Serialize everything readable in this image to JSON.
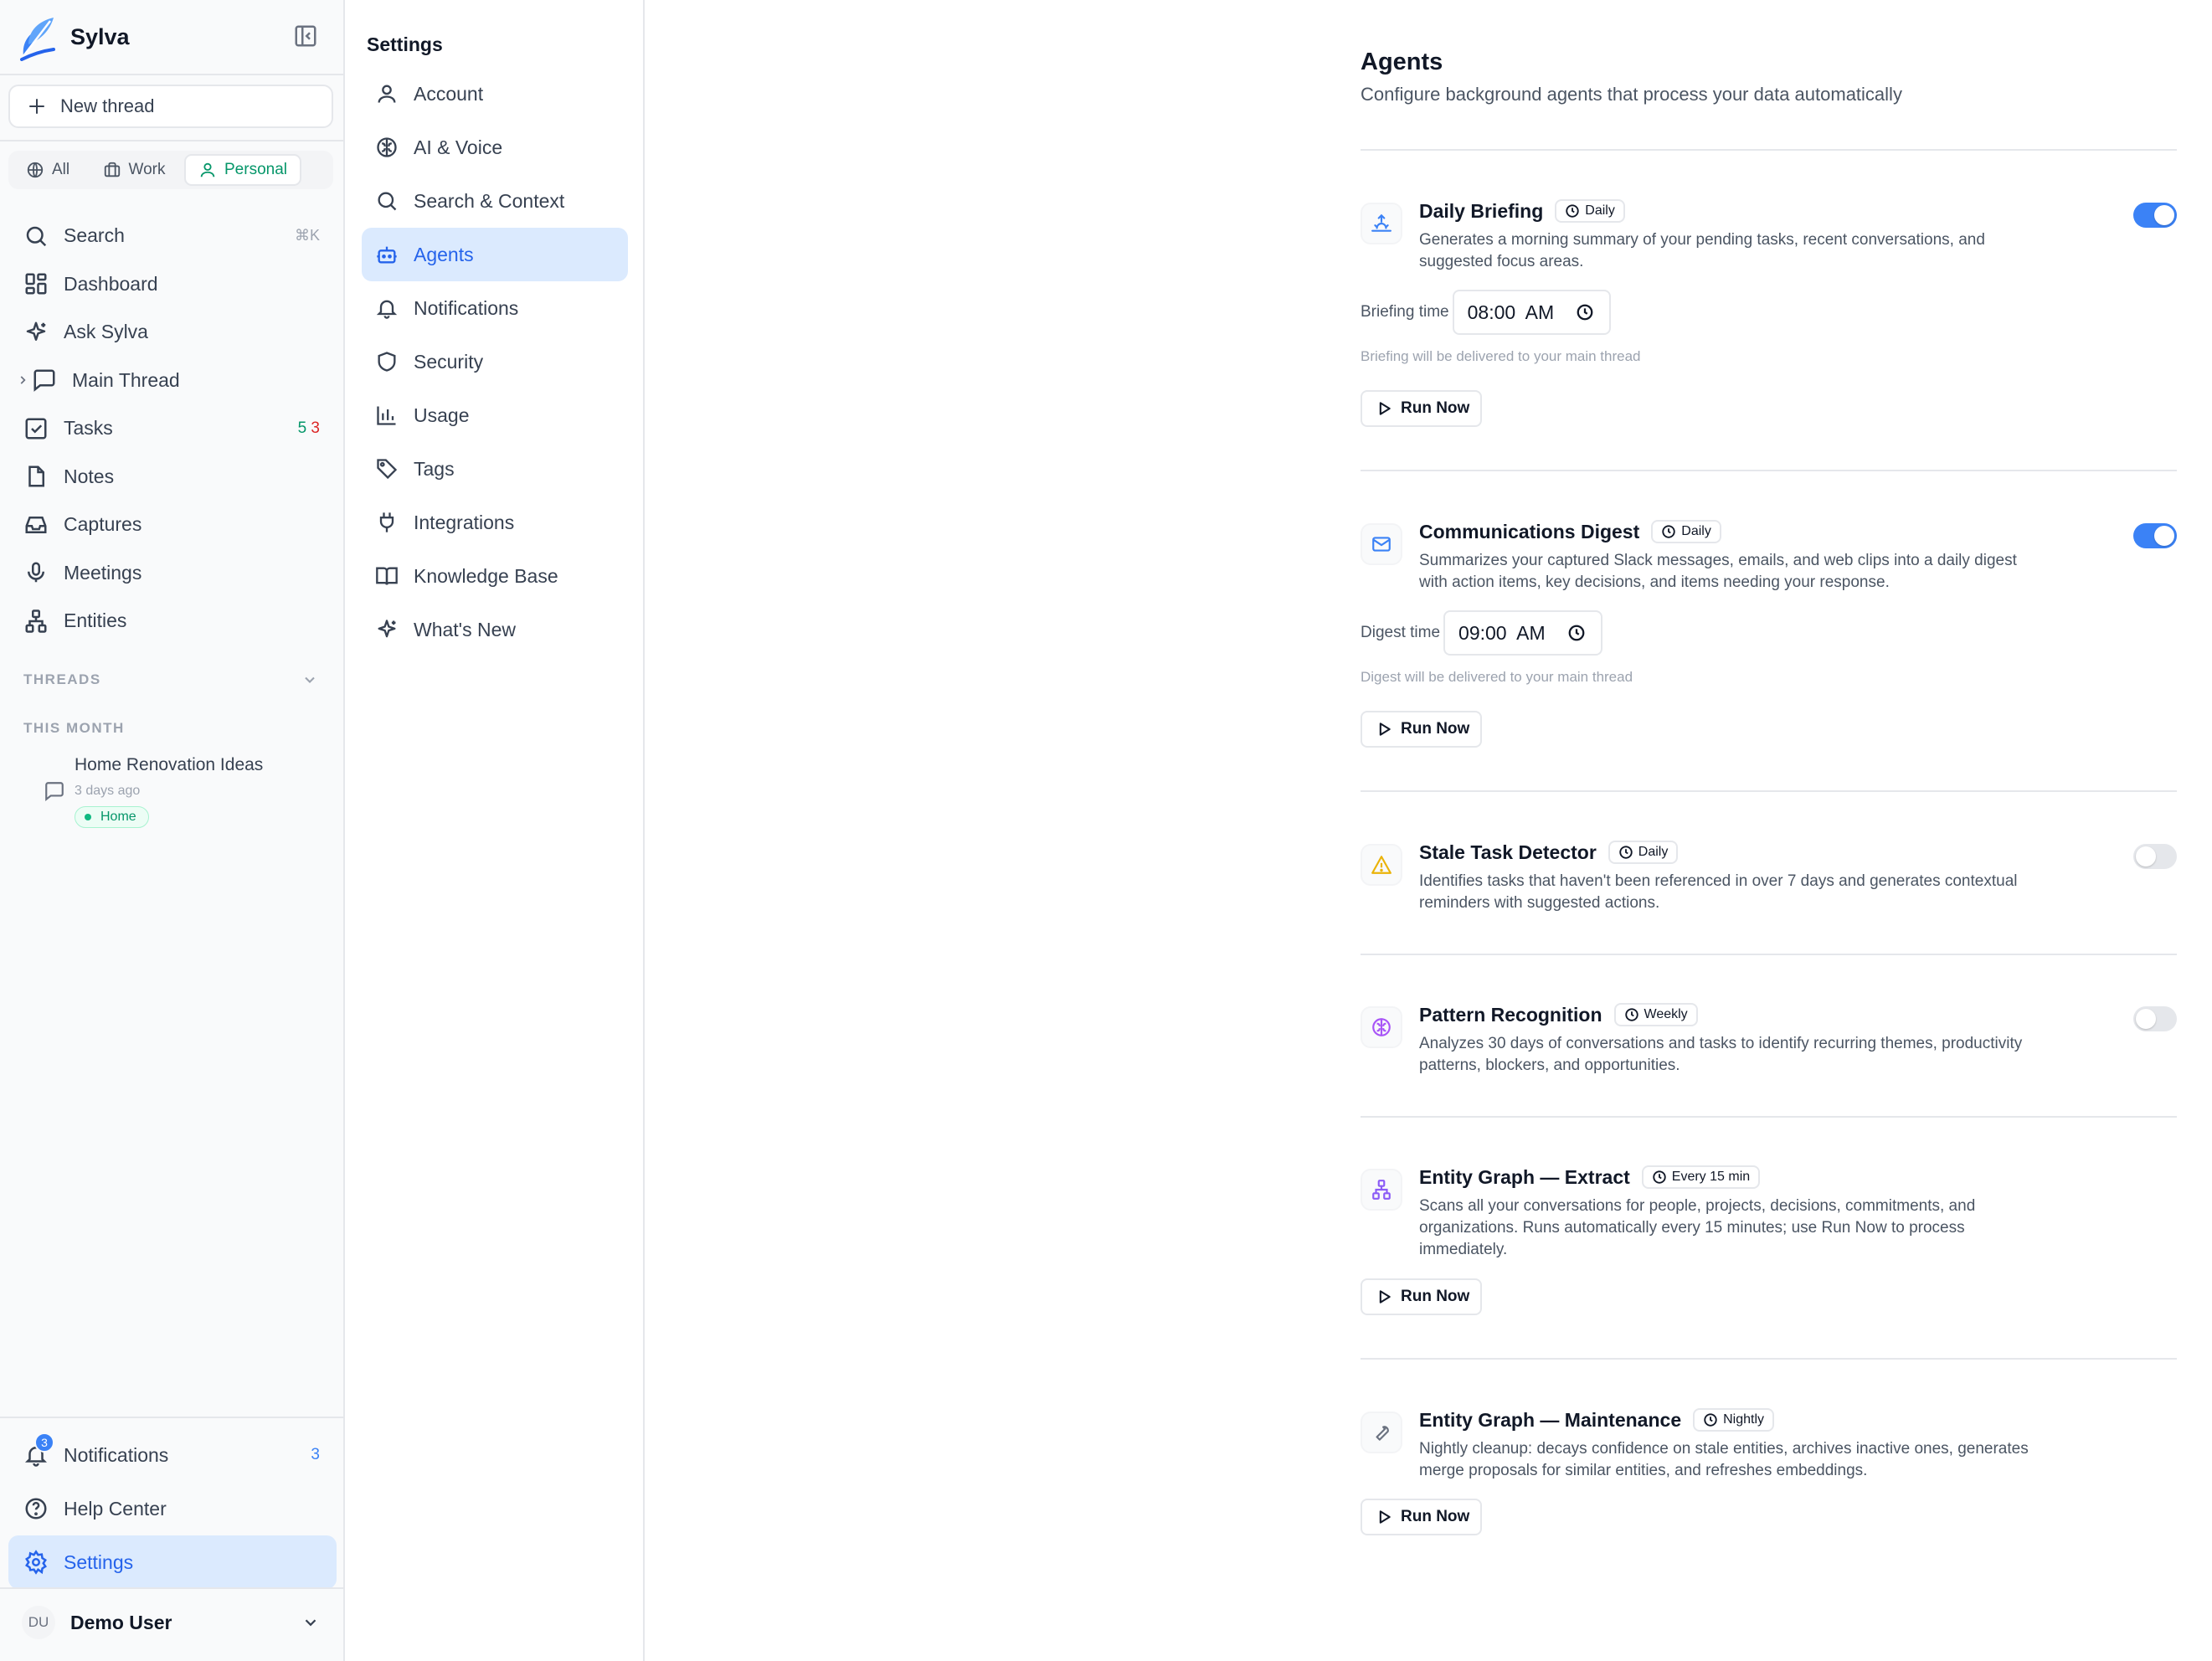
{
  "app": {
    "name": "Sylva",
    "new_thread": "New thread",
    "scopes": [
      "All",
      "Work",
      "Personal"
    ],
    "active_scope": "Personal"
  },
  "nav": {
    "search": "Search",
    "search_shortcut": "⌘K",
    "dashboard": "Dashboard",
    "ask": "Ask Sylva",
    "main_thread": "Main Thread",
    "tasks": "Tasks",
    "tasks_count_a": "5",
    "tasks_count_b": "3",
    "notes": "Notes",
    "captures": "Captures",
    "meetings": "Meetings",
    "entities": "Entities"
  },
  "threads": {
    "section": "THREADS",
    "period": "THIS MONTH",
    "items": [
      {
        "title": "Home Renovation Ideas",
        "date": "3 days ago",
        "tag": "Home"
      }
    ]
  },
  "bottom": {
    "notifications": "Notifications",
    "notifications_badge": "3",
    "notifications_count": "3",
    "help": "Help Center",
    "settings": "Settings"
  },
  "user": {
    "initials": "DU",
    "name": "Demo User"
  },
  "settings_nav": {
    "title": "Settings",
    "items": [
      "Account",
      "AI & Voice",
      "Search & Context",
      "Agents",
      "Notifications",
      "Security",
      "Usage",
      "Tags",
      "Integrations",
      "Knowledge Base",
      "What's New"
    ],
    "active": "Agents"
  },
  "page": {
    "title": "Agents",
    "subtitle": "Configure background agents that process your data automatically"
  },
  "run_now": "Run Now",
  "agents": [
    {
      "name": "Daily Briefing",
      "frequency": "Daily",
      "description": "Generates a morning summary of your pending tasks, recent conversations, and suggested focus areas.",
      "enabled": true,
      "time_label": "Briefing time",
      "time": "08:00  AM",
      "hint": "Briefing will be delivered to your main thread",
      "icon": "sunrise-icon",
      "color": "#3b82f6"
    },
    {
      "name": "Communications Digest",
      "frequency": "Daily",
      "description": "Summarizes your captured Slack messages, emails, and web clips into a daily digest with action items, key decisions, and items needing your response.",
      "enabled": true,
      "time_label": "Digest time",
      "time": "09:00  AM",
      "hint": "Digest will be delivered to your main thread",
      "icon": "mail-icon",
      "color": "#3b82f6"
    },
    {
      "name": "Stale Task Detector",
      "frequency": "Daily",
      "description": "Identifies tasks that haven't been referenced in over 7 days and generates contextual reminders with suggested actions.",
      "enabled": false,
      "icon": "warning-icon",
      "color": "#eab308"
    },
    {
      "name": "Pattern Recognition",
      "frequency": "Weekly",
      "description": "Analyzes 30 days of conversations and tasks to identify recurring themes, productivity patterns, blockers, and opportunities.",
      "enabled": false,
      "icon": "brain-icon",
      "color": "#a855f7"
    },
    {
      "name": "Entity Graph — Extract",
      "frequency": "Every 15 min",
      "description": "Scans all your conversations for people, projects, decisions, commitments, and organizations. Runs automatically every 15 minutes; use Run Now to process immediately.",
      "icon": "network-icon",
      "color": "#8b5cf6"
    },
    {
      "name": "Entity Graph — Maintenance",
      "frequency": "Nightly",
      "description": "Nightly cleanup: decays confidence on stale entities, archives inactive ones, generates merge proposals for similar entities, and refreshes embeddings.",
      "icon": "wrench-icon",
      "color": "#6b7280"
    }
  ],
  "colors": {
    "accent": "#3b82f6",
    "success": "#059669",
    "danger": "#dc2626"
  }
}
